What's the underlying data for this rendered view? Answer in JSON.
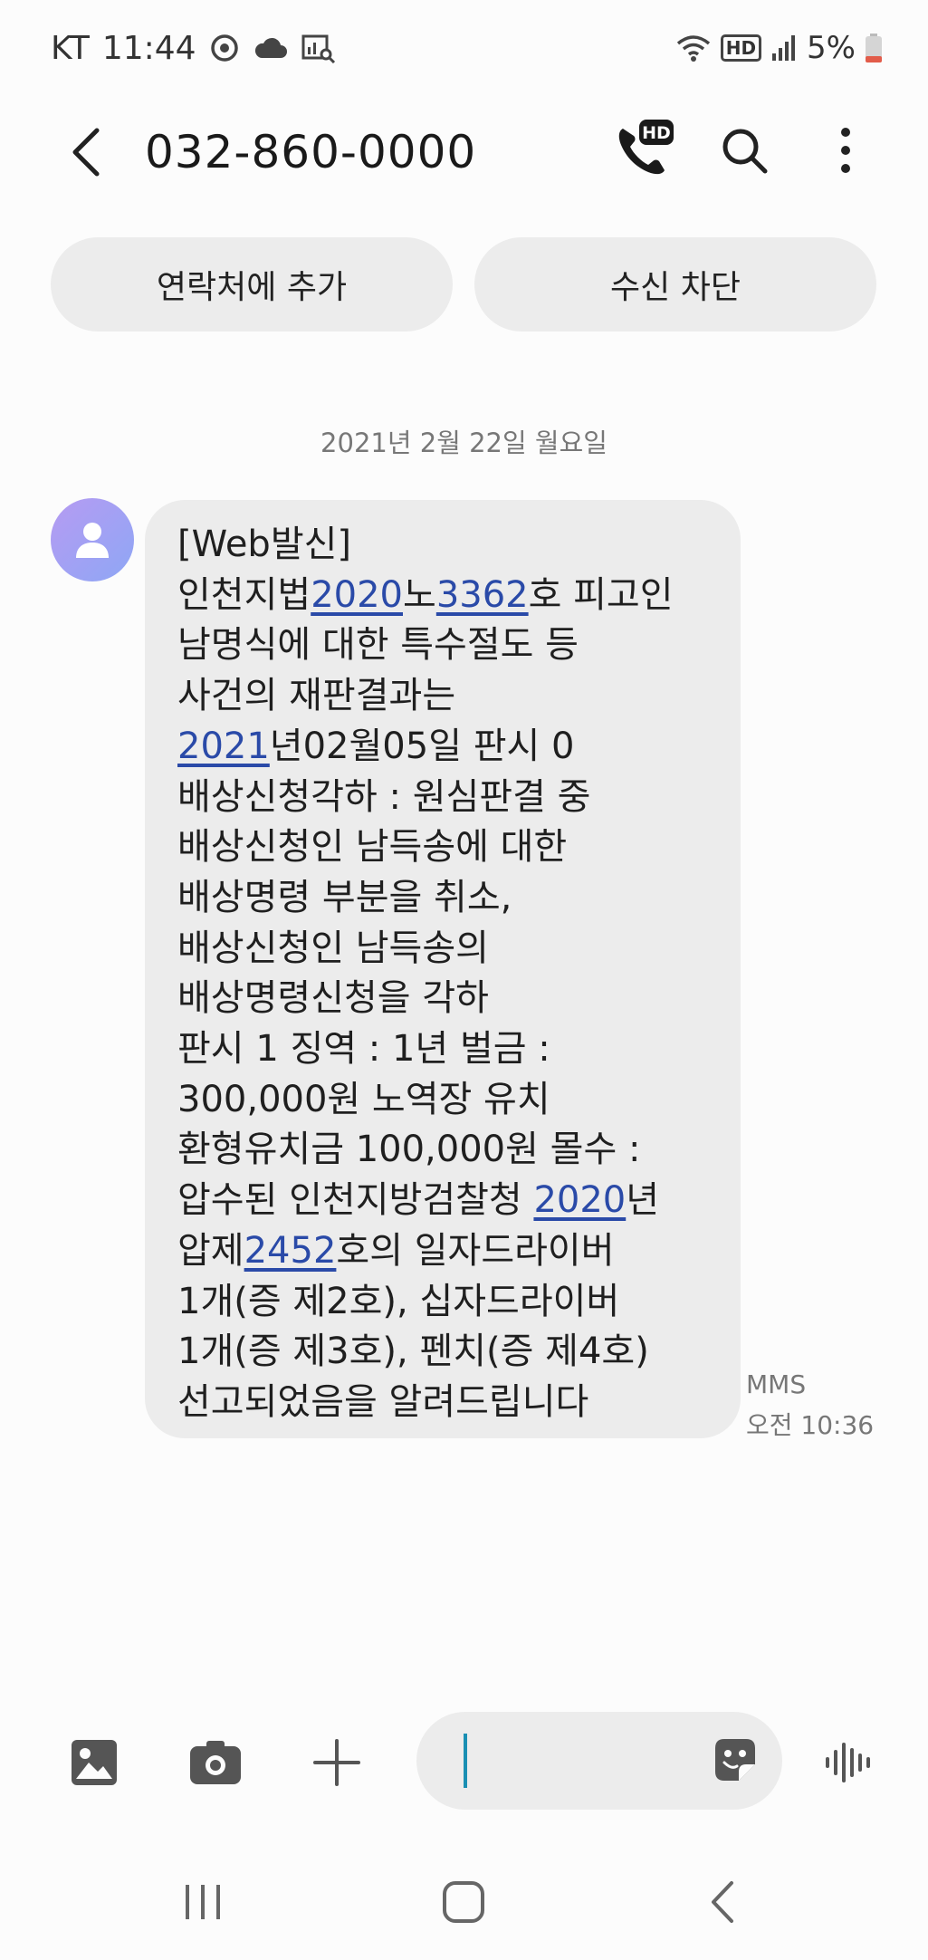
{
  "status_bar": {
    "carrier": "KT",
    "time": "11:44",
    "battery": "5%",
    "hd_label": "HD"
  },
  "header": {
    "title": "032-860-0000",
    "hd_call_badge": "HD"
  },
  "actions": {
    "add_contact": "연락처에 추가",
    "block": "수신 차단"
  },
  "conversation": {
    "date": "2021년 2월 22일 월요일",
    "message": {
      "type": "MMS",
      "time": "오전 10:36",
      "lines": [
        [
          {
            "t": "[Web발신]"
          }
        ],
        [
          {
            "t": "인천지법"
          },
          {
            "t": "2020",
            "link": true
          },
          {
            "t": "노"
          },
          {
            "t": "3362",
            "link": true
          },
          {
            "t": "호 피고인"
          }
        ],
        [
          {
            "t": "남명식에 대한 특수절도 등"
          }
        ],
        [
          {
            "t": "사건의 재판결과는"
          }
        ],
        [
          {
            "t": "2021",
            "link": true
          },
          {
            "t": "년02월05일 판시 0"
          }
        ],
        [
          {
            "t": "배상신청각하 : 원심판결 중"
          }
        ],
        [
          {
            "t": "배상신청인 남득송에 대한"
          }
        ],
        [
          {
            "t": "배상명령 부분을 취소,"
          }
        ],
        [
          {
            "t": "배상신청인 남득송의"
          }
        ],
        [
          {
            "t": "배상명령신청을 각하"
          }
        ],
        [
          {
            "t": "판시 1  징역 : 1년 벌금 :"
          }
        ],
        [
          {
            "t": "300,000원 노역장 유치"
          }
        ],
        [
          {
            "t": "환형유치금 100,000원 몰수 :"
          }
        ],
        [
          {
            "t": "압수된 인천지방검찰청 "
          },
          {
            "t": "2020",
            "link": true
          },
          {
            "t": "년"
          }
        ],
        [
          {
            "t": "압제"
          },
          {
            "t": "2452",
            "link": true
          },
          {
            "t": "호의 일자드라이버"
          }
        ],
        [
          {
            "t": "1개(증 제2호), 십자드라이버"
          }
        ],
        [
          {
            "t": "1개(증 제3호), 펜치(증 제4호)"
          }
        ],
        [
          {
            "t": "선고되었음을 알려드립니다"
          }
        ]
      ]
    }
  },
  "colors": {
    "link": "#2a4aa8",
    "bubble": "#ececec",
    "caret": "#1a8fb3",
    "avatar_start": "#b69bf2",
    "avatar_end": "#8ea7f5"
  }
}
